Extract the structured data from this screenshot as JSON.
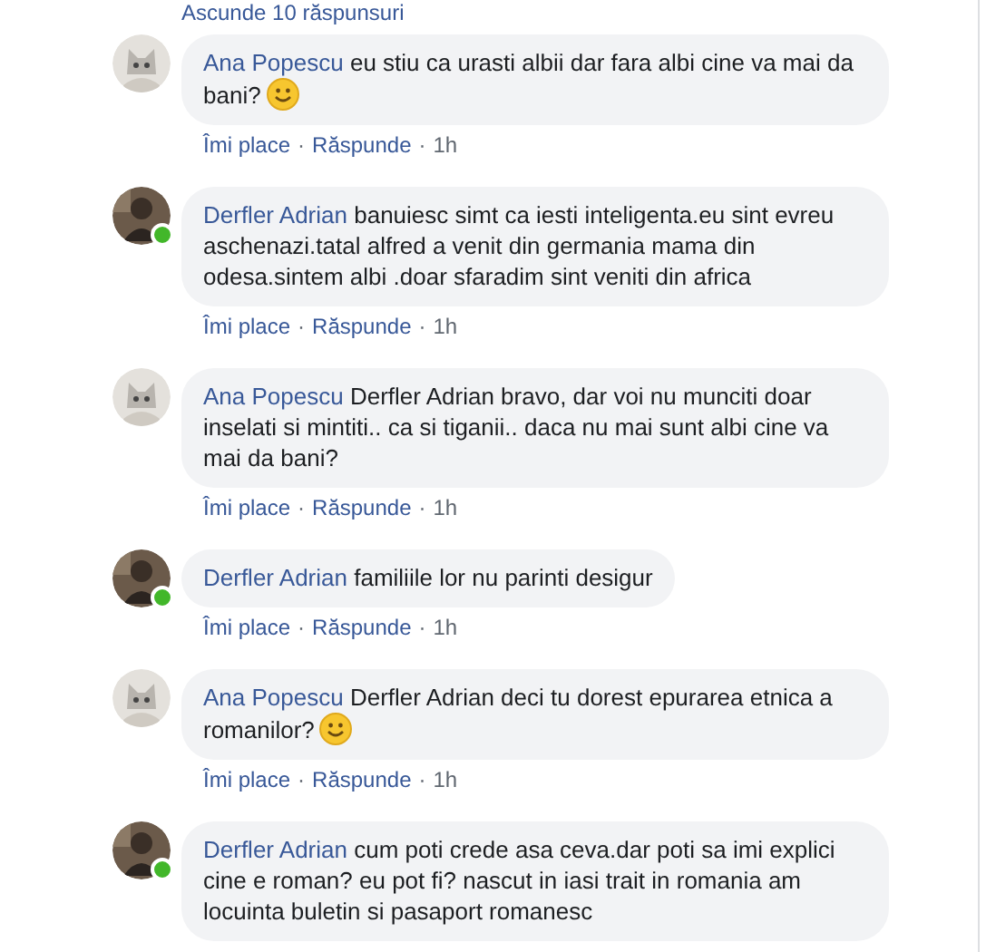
{
  "hide_replies_link": "Ascunde 10 răspunsuri",
  "comments": [
    {
      "kind": "cat",
      "online": false,
      "author": "Ana Popescu",
      "text": "eu stiu ca urasti albii dar fara albi cine va mai da bani?",
      "emoji": true,
      "like": "Îmi place",
      "sep1": "·",
      "reply": "Răspunde",
      "sep2": "·",
      "time": "1h"
    },
    {
      "kind": "photo",
      "online": true,
      "author": "Derfler Adrian",
      "text": "banuiesc simt ca iesti inteligenta.eu sint evreu aschenazi.tatal alfred a venit din germania mama din odesa.sintem albi .doar sfaradim sint veniti din africa",
      "emoji": false,
      "like": "Îmi place",
      "sep1": "·",
      "reply": "Răspunde",
      "sep2": "·",
      "time": "1h"
    },
    {
      "kind": "cat",
      "online": false,
      "author": "Ana Popescu",
      "text": "Derfler Adrian bravo, dar voi nu munciti doar inselati si mintiti.. ca si tiganii.. daca nu mai sunt albi cine va mai da bani?",
      "emoji": false,
      "like": "Îmi place",
      "sep1": "·",
      "reply": "Răspunde",
      "sep2": "·",
      "time": "1h"
    },
    {
      "kind": "photo",
      "online": true,
      "author": "Derfler Adrian",
      "text": "familiile lor nu parinti desigur",
      "emoji": false,
      "like": "Îmi place",
      "sep1": "·",
      "reply": "Răspunde",
      "sep2": "·",
      "time": "1h"
    },
    {
      "kind": "cat",
      "online": false,
      "author": "Ana Popescu",
      "text": "Derfler Adrian deci tu dorest epurarea etnica a romanilor?",
      "emoji": true,
      "like": "Îmi place",
      "sep1": "·",
      "reply": "Răspunde",
      "sep2": "·",
      "time": "1h"
    },
    {
      "kind": "photo",
      "online": true,
      "author": "Derfler Adrian",
      "text": "cum poti crede asa ceva.dar poti sa imi explici cine e roman? eu pot fi? nascut in iasi trait in romania am locuinta buletin si pasaport romanesc",
      "emoji": false
    }
  ]
}
